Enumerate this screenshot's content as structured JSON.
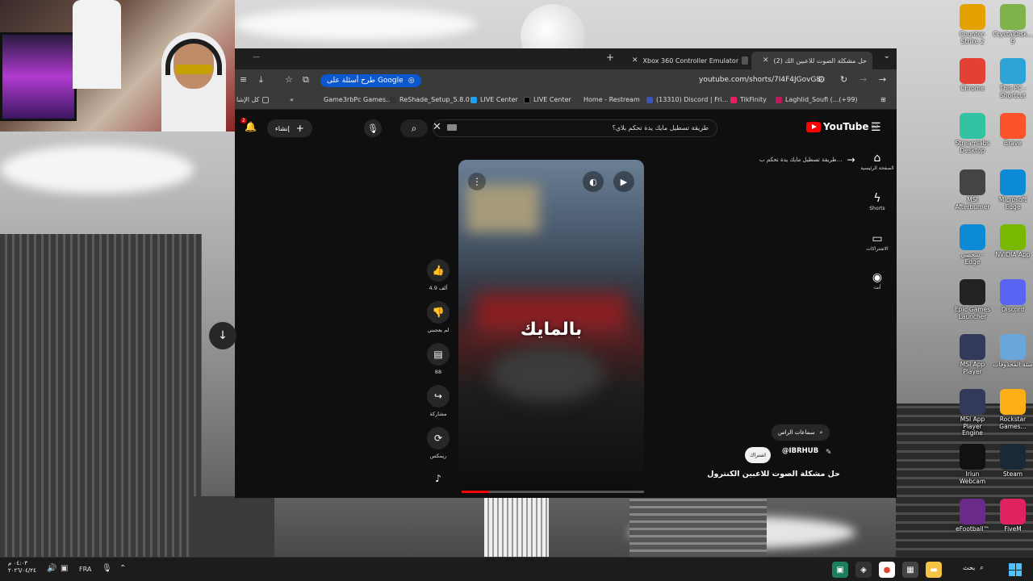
{
  "webcam": {
    "label": ""
  },
  "browser": {
    "tabs": [
      {
        "label": "Xbox 360 Controller Emulator",
        "active": false
      },
      {
        "label": "(2) حل مشكلة الصوت للاعبين الك",
        "active": true
      }
    ],
    "toolbar": {
      "google_label": "طرح أسئلة على Google",
      "url": "youtube.com/shorts/7I4F4JGovG8"
    },
    "bookmarks": [
      {
        "label": "كل الإشا"
      },
      {
        "label": "«"
      },
      {
        "label": "Game3rbPc Games..."
      },
      {
        "label": "ReShade_Setup_5.8.0"
      },
      {
        "label": "LIVE Center"
      },
      {
        "label": "LIVE Center"
      },
      {
        "label": "Home - Restream"
      },
      {
        "label": "(13310) Discord | Fri..."
      },
      {
        "label": "TikFinity"
      },
      {
        "label": "Laghlid_Soufi (...(+99)"
      }
    ]
  },
  "youtube": {
    "logo": "YouTube",
    "region": "DZ",
    "search_query": "طريقة تسطيل مايك يدة تحكم بلاي؟",
    "create_label": "إنشاء",
    "notification_count": "2",
    "guide": [
      {
        "label": "الصفحة الرئيسية",
        "icon": "home-icon"
      },
      {
        "label": "Shorts",
        "icon": "shorts-icon"
      },
      {
        "label": "الاشتراكات",
        "icon": "subscriptions-icon"
      },
      {
        "label": "أنت",
        "icon": "you-icon"
      }
    ],
    "prev_hint": "طريقة تسطيل مايك يدة تحكم ب...",
    "video": {
      "caption": "بالمايك",
      "progress": 0.15
    },
    "actions": [
      {
        "label": "4.9 ألف",
        "icon": "like-icon"
      },
      {
        "label": "لم يعجبني",
        "icon": "dislike-icon"
      },
      {
        "label": "88",
        "icon": "comment-icon"
      },
      {
        "label": "مشاركة",
        "icon": "share-icon"
      },
      {
        "label": "ريمكس",
        "icon": "remix-icon"
      },
      {
        "label": "",
        "icon": "sound-icon"
      }
    ],
    "tag_chip": "سماعات الراس",
    "channel": "@IBRHUB",
    "subscribe_label": "اشتراك",
    "title": "حل مشكلة الصوت للاعبين الكنترول"
  },
  "desktop_icons": [
    {
      "label": "Counter-Strike 2",
      "color": "#e6a100"
    },
    {
      "label": "CrystalDisk... 9",
      "color": "#7fb24a"
    },
    {
      "label": "Chrome",
      "color": "#e34133"
    },
    {
      "label": "This PC - Shortcut",
      "color": "#2fa3d8"
    },
    {
      "label": "Streamlabs Desktop",
      "color": "#31c3a2"
    },
    {
      "label": "Brave",
      "color": "#fb542b"
    },
    {
      "label": "MSI Afterburner",
      "color": "#444"
    },
    {
      "label": "Microsoft Edge",
      "color": "#0c8ad6"
    },
    {
      "label": "شخصي - Edge",
      "color": "#0c8ad6"
    },
    {
      "label": "NVIDIA App",
      "color": "#76b900"
    },
    {
      "label": "Epic Games Launcher",
      "color": "#222"
    },
    {
      "label": "Discord",
      "color": "#5865f2"
    },
    {
      "label": "MSI App Player",
      "color": "#33395a"
    },
    {
      "label": "سلة المحذوفات",
      "color": "#6aa6d8"
    },
    {
      "label": "MSI App Player Engine",
      "color": "#33395a"
    },
    {
      "label": "Rockstar Games...",
      "color": "#fcaf17"
    },
    {
      "label": "Iriun Webcam",
      "color": "#111"
    },
    {
      "label": "Steam",
      "color": "#1b2838"
    },
    {
      "label": "eFootball™",
      "color": "#6a2a8a"
    },
    {
      "label": "FiveM",
      "color": "#e0235e"
    }
  ],
  "taskbar": {
    "time": "٠٤:٠٣ م",
    "date": "٢٠٢٦/٠٤/٢٤",
    "language": "FRA",
    "search_label": "بحث"
  }
}
